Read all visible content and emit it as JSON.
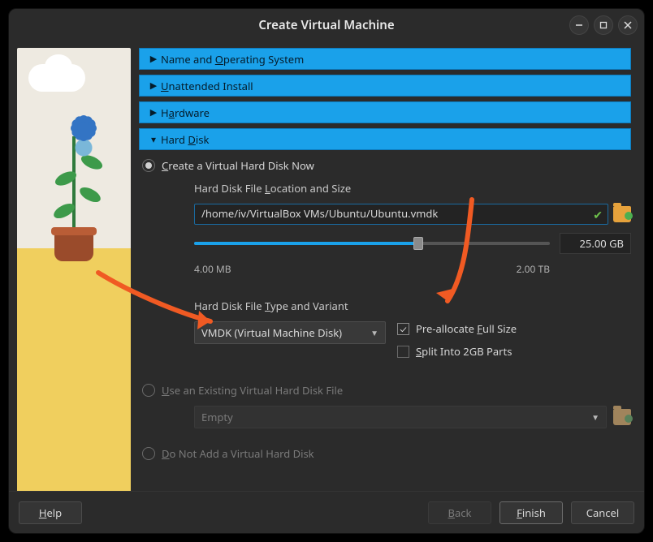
{
  "window": {
    "title": "Create Virtual Machine"
  },
  "accordion": {
    "name_os": "Name and Operating System",
    "name_os_u": "O",
    "unattended": "Unattended Install",
    "unattended_u": "U",
    "hardware": "Hardware",
    "hardware_u": "a",
    "harddisk": "Hard Disk",
    "harddisk_u": "D"
  },
  "harddisk": {
    "radio_create": "Create a Virtual Hard Disk Now",
    "radio_create_u": "C",
    "loc_size_header": "Hard Disk File Location and Size",
    "loc_size_u": "L",
    "path": "/home/iv/VirtualBox VMs/Ubuntu/Ubuntu.vmdk",
    "size_value": "25.00 GB",
    "range_min": "4.00 MB",
    "range_max": "2.00 TB",
    "slider_fill_pct": 63,
    "type_variant_header": "Hard Disk File Type and Variant",
    "type_variant_u": "T",
    "type_selected": "VMDK (Virtual Machine Disk)",
    "preallocate": "Pre-allocate Full Size",
    "preallocate_u": "F",
    "preallocate_checked": true,
    "split": "Split Into 2GB Parts",
    "split_u": "S",
    "split_checked": false,
    "radio_existing": "Use an Existing Virtual Hard Disk File",
    "radio_existing_u": "U",
    "existing_placeholder": "Empty",
    "radio_none": "Do Not Add a Virtual Hard Disk",
    "radio_none_u": "D"
  },
  "footer": {
    "help": "Help",
    "help_u": "H",
    "back": "Back",
    "back_u": "B",
    "finish": "Finish",
    "finish_u": "F",
    "cancel": "Cancel"
  }
}
